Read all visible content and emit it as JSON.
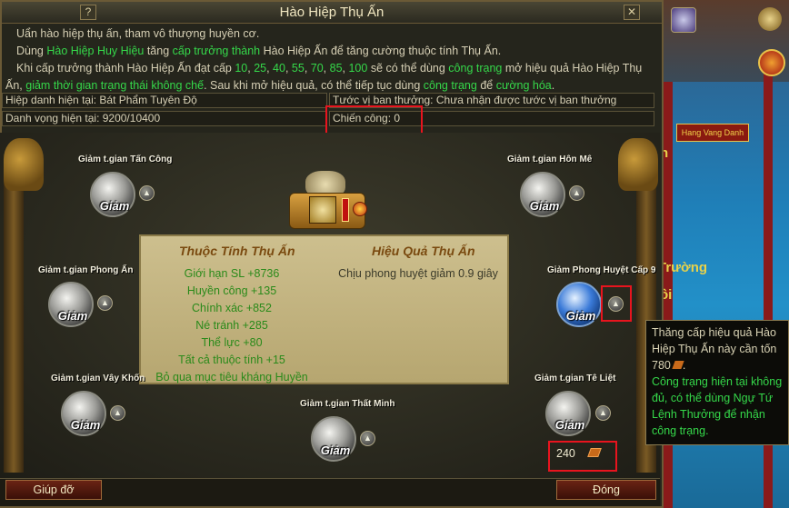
{
  "window": {
    "title": "Hào Hiệp Thụ Ấn",
    "help_btn": "?",
    "close_btn": "✕"
  },
  "intro": {
    "line1": "Uẩn hào hiệp thụ ấn, tham vô thượng huyền cơ.",
    "line2_a": "Dùng ",
    "line2_b": "Hào Hiệp Huy Hiệu",
    "line2_c": " tăng ",
    "line2_d": "cấp trưởng thành",
    "line2_e": " Hào Hiệp Ấn để tăng cường thuộc tính Thụ Ấn.",
    "line3_a": "Khi cấp trưởng thành Hào Hiệp Ấn đạt cấp ",
    "line3_levels": [
      "10",
      "25",
      "40",
      "55",
      "70",
      "85",
      "100"
    ],
    "line3_b": " sẽ có thể dùng ",
    "line3_c": "công trạng",
    "line3_d": " mở hiệu quả Hào Hiệp Thụ",
    "line4_a": "Ấn, ",
    "line4_b": "giảm thời gian trạng thái không chế",
    "line4_c": ". Sau khi mở hiệu quả, có thể tiếp tục dùng ",
    "line4_d": "công trạng",
    "line4_e": " để ",
    "line4_f": "cường hóa",
    "line4_g": "."
  },
  "info": {
    "title_current": "Hiệp danh hiện tại: Bát Phẩm Tuyên Độ",
    "rank_reward": "Tước vị ban thưởng: Chưa nhận được tước vị ban thưởng",
    "reputation": "Danh vọng hiện tại: 9200/10400",
    "merit": "Chiến công: 0"
  },
  "panel": {
    "attr_head": "Thuộc Tính Thụ Ấn",
    "effect_head": "Hiệu Quả Thụ Ấn",
    "stats": [
      "Giới hạn SL +8736",
      "Huyền công +135",
      "Chính xác +852",
      "Né tránh +285",
      "Thể lực +80",
      "Tất cả thuộc tính +15",
      "Bỏ qua mục tiêu kháng Huyền"
    ],
    "effect": "Chịu phong huyệt giảm 0.9 giây"
  },
  "skills": {
    "orb_text": "Giảm",
    "s1": "Giảm t.gian Tấn Công",
    "s2": "Giảm t.gian Hôn Mê",
    "s3": "Giảm t.gian Phong Ấn",
    "s4": "Giảm Phong Huyệt Cấp 9",
    "s5": "Giảm t.gian Vây Khốn",
    "s6": "Giảm t.gian Tê Liệt",
    "s7": "Giảm t.gian Thất Minh"
  },
  "tooltip": {
    "l1": "Thăng cấp hiệu quả Hào",
    "l2": "Hiệp Thụ Ấn này cần tốn",
    "l3": "780",
    "l4": "Công trạng hiện tại không",
    "l5": "đủ, có thể dùng Ngự Tứ",
    "l6": "Lệnh Thưởng để nhận",
    "l7": "công trạng."
  },
  "cost": "240",
  "buttons": {
    "help": "Giúp đỡ",
    "close": "Đóng"
  },
  "scene": {
    "banner": "Hang Vang Danh",
    "text1": "Trường",
    "text2": "ồi",
    "text3": "n"
  },
  "colors": {
    "highlight_green": "#35d84a",
    "red_outline": "#e8141e",
    "gold": "#f0e6c0"
  }
}
